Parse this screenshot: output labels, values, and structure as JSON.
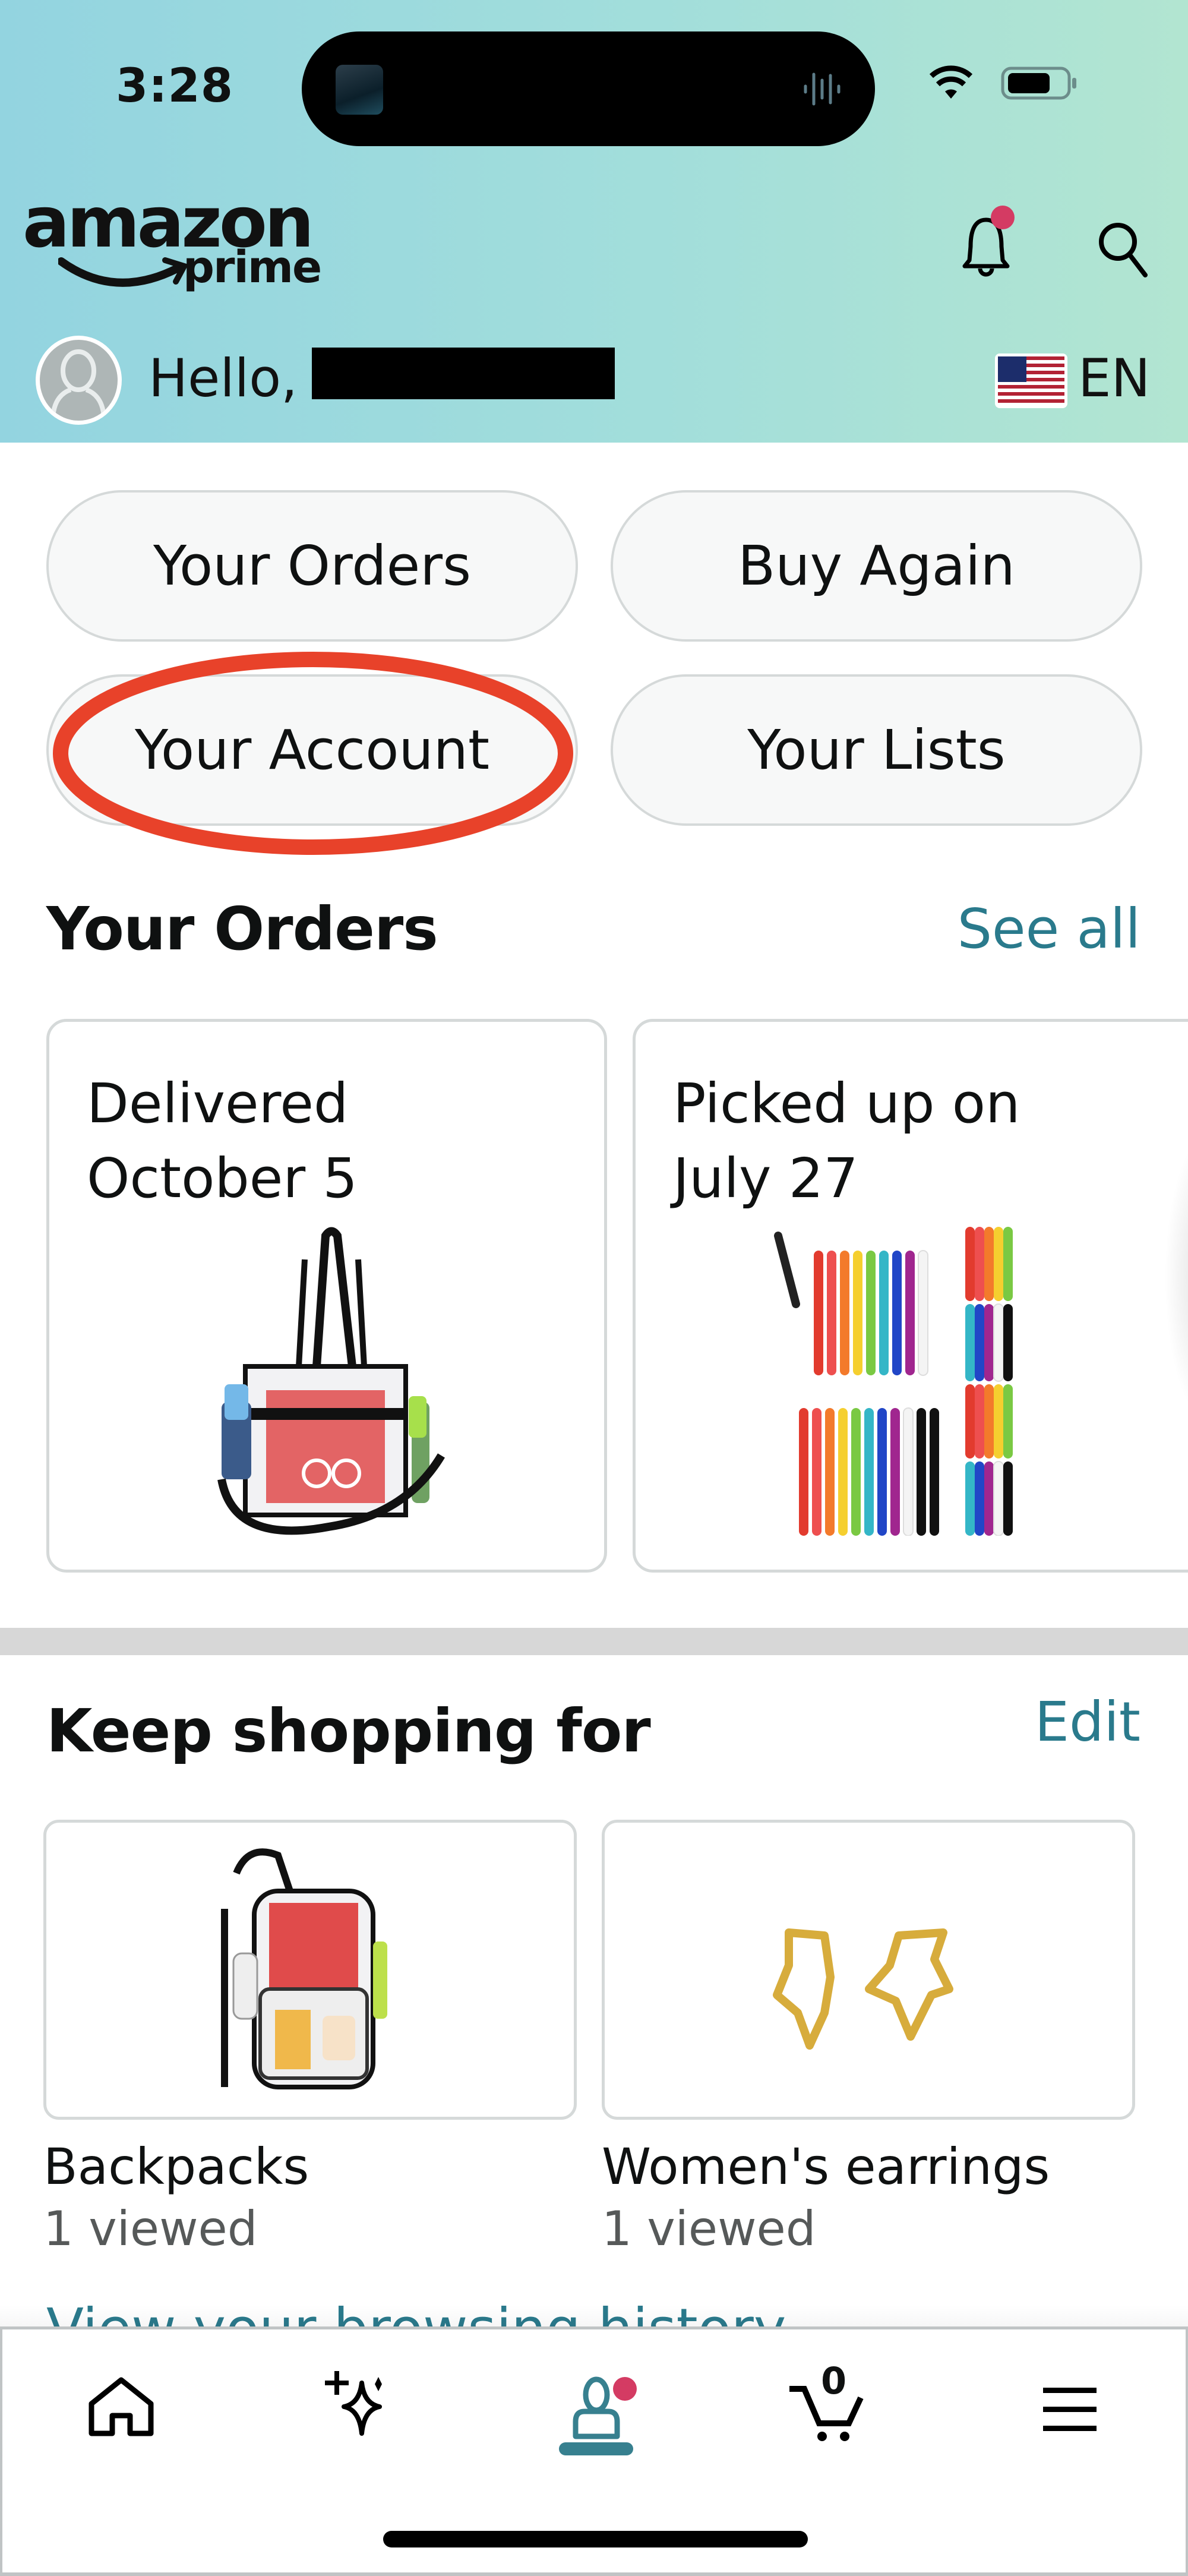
{
  "status_bar": {
    "time": "3:28",
    "icons": [
      "now-playing-artwork",
      "audio-waveform-icon",
      "wifi-icon",
      "battery-icon"
    ]
  },
  "header": {
    "logo_word": "amazon",
    "logo_sub": "prime",
    "notification_badge": true,
    "greeting": "Hello,",
    "user_name_redacted": true,
    "language": "EN",
    "country_flag": "US",
    "colors": {
      "gradient_start": "#93d4e0",
      "gradient_end": "#b2e5d1",
      "badge": "#d43b63"
    }
  },
  "quick_actions": [
    {
      "label": "Your Orders"
    },
    {
      "label": "Buy Again"
    },
    {
      "label": "Your Account",
      "annotated": true
    },
    {
      "label": "Your Lists"
    }
  ],
  "annotation": {
    "shape": "ellipse",
    "color": "#e8422a",
    "target": "Your Account"
  },
  "orders_section": {
    "title": "Your Orders",
    "link": "See all",
    "cards": [
      {
        "status_line1": "Delivered",
        "status_line2": "October 5",
        "image": "clear tote bag"
      },
      {
        "status_line1": "Picked up on",
        "status_line2": "July 27",
        "image": "colorful cable ties"
      }
    ]
  },
  "keep_shopping": {
    "title": "Keep shopping for",
    "link": "Edit",
    "items": [
      {
        "label": "Backpacks",
        "sub": "1 viewed",
        "image": "clear backpack"
      },
      {
        "label": "Women's earrings",
        "sub": "1 viewed",
        "image": "gold star hoop earrings"
      }
    ],
    "footer_link": "View your browsing history"
  },
  "bottom_nav": {
    "items": [
      {
        "name": "home",
        "icon": "home-icon"
      },
      {
        "name": "rufus",
        "icon": "sparkle-icon"
      },
      {
        "name": "you",
        "icon": "person-icon",
        "active": true,
        "badge": true
      },
      {
        "name": "cart",
        "icon": "cart-icon",
        "count": "0"
      },
      {
        "name": "menu",
        "icon": "hamburger-menu-icon"
      }
    ],
    "active_color": "#37808f"
  },
  "link_color": "#2a7a8c"
}
